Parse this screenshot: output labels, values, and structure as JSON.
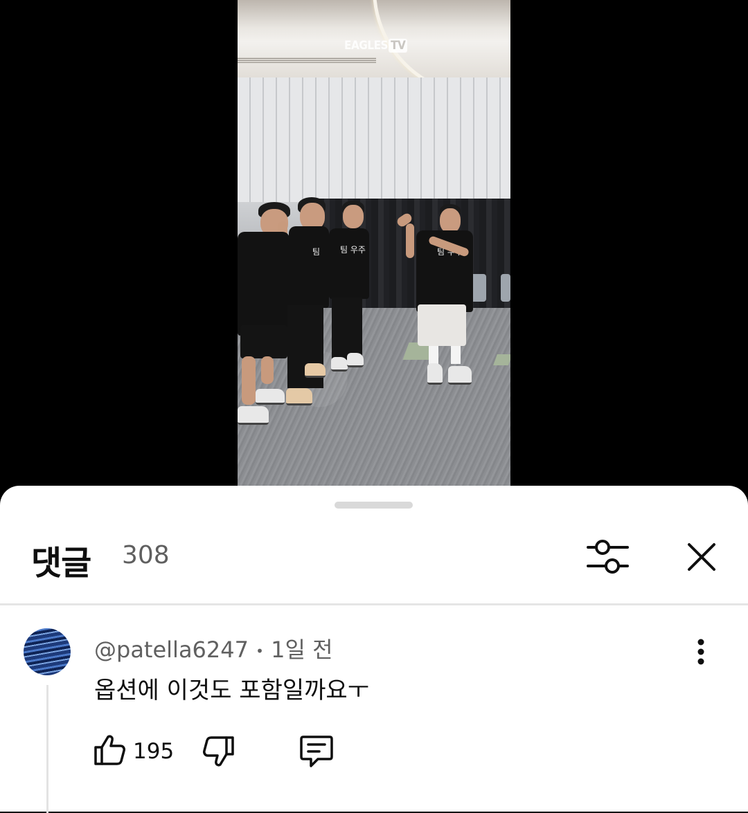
{
  "video": {
    "watermark_main": "EAGLES",
    "watermark_tv": "TV",
    "shirt_texts": [
      "팀",
      "팀 우주",
      "팀 우주"
    ]
  },
  "comments_panel": {
    "title": "댓글",
    "count": "308"
  },
  "comment": {
    "author": "@patella6247",
    "separator": "•",
    "time": "1일 전",
    "text": "옵션에 이것도 포함일까요ㅜ",
    "likes": "195"
  }
}
